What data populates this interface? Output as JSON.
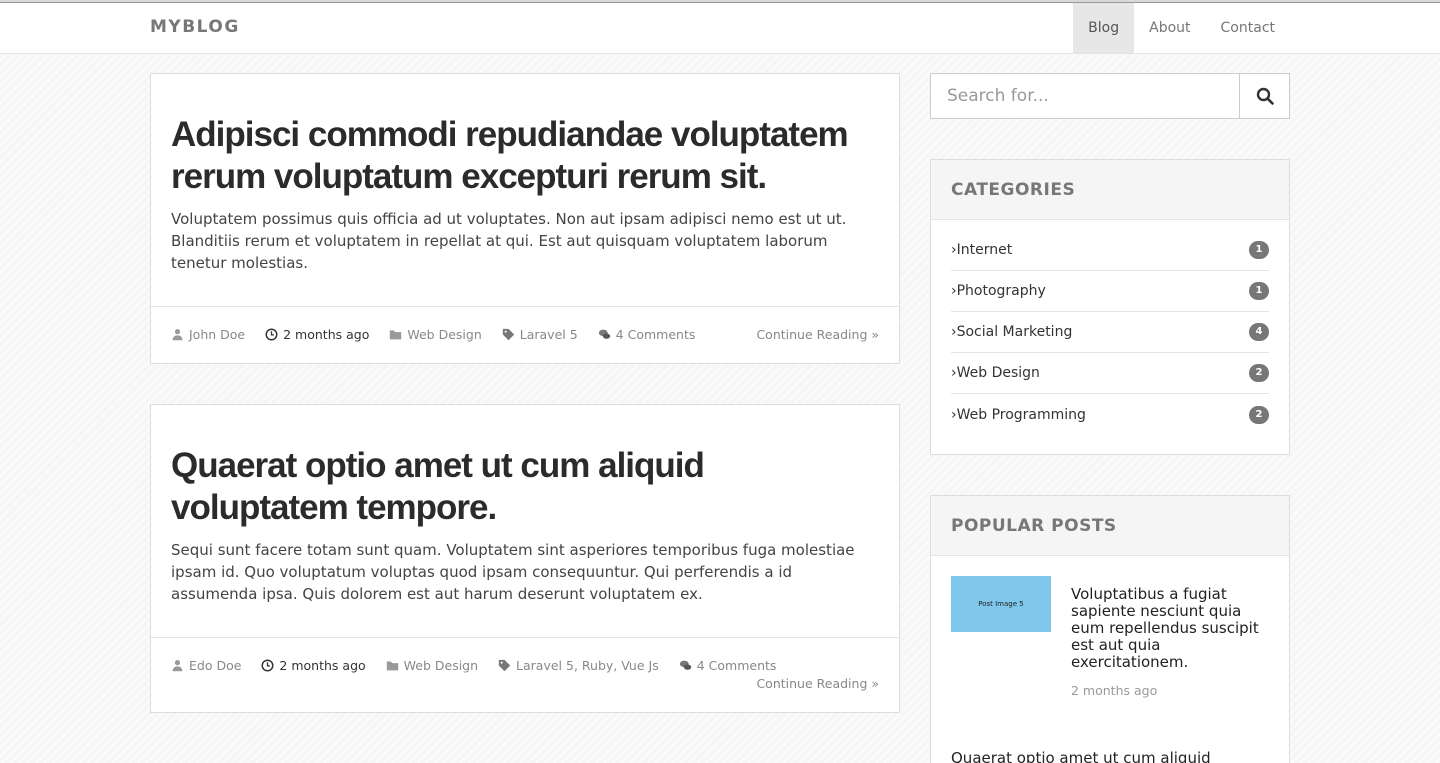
{
  "navbar": {
    "brand": "MYBLOG",
    "links": [
      "Blog",
      "About",
      "Contact"
    ],
    "active": "Blog"
  },
  "posts": [
    {
      "title": "Adipisci commodi repudiandae voluptatem rerum voluptatum excepturi rerum sit.",
      "excerpt": "Voluptatem possimus quis officia ad ut voluptates. Non aut ipsam adipisci nemo est ut ut. Blanditiis rerum et voluptatem in repellat at qui. Est aut quisquam voluptatem laborum tenetur molestias.",
      "author": "John Doe",
      "time": "2 months ago",
      "category": "Web Design",
      "tags": "Laravel 5",
      "comments": "4 Comments",
      "continue": "Continue Reading »"
    },
    {
      "title": "Quaerat optio amet ut cum aliquid voluptatem tempore.",
      "excerpt": "Sequi sunt facere totam sunt quam. Voluptatem sint asperiores temporibus fuga molestiae ipsam id. Quo voluptatum voluptas quod ipsam consequuntur. Qui perferendis a id assumenda ipsa. Quis dolorem est aut harum deserunt voluptatem ex.",
      "author": "Edo Doe",
      "time": "2 months ago",
      "category": "Web Design",
      "tags": "Laravel 5, Ruby, Vue Js",
      "comments": "4 Comments",
      "continue": "Continue Reading »"
    }
  ],
  "search": {
    "placeholder": "Search for..."
  },
  "categories": {
    "title": "CATEGORIES",
    "items": [
      {
        "label": "›Internet",
        "count": "1"
      },
      {
        "label": "›Photography",
        "count": "1"
      },
      {
        "label": "›Social Marketing",
        "count": "4"
      },
      {
        "label": "›Web Design",
        "count": "2"
      },
      {
        "label": "›Web Programming",
        "count": "2"
      }
    ]
  },
  "popular": {
    "title": "POPULAR POSTS",
    "items": [
      {
        "thumb": "Post Image 5",
        "title": "Voluptatibus a fugiat sapiente nesciunt quia eum repellendus suscipit est aut quia exercitationem.",
        "date": "2 months ago"
      },
      {
        "title": "Quaerat optio amet ut cum aliquid"
      }
    ]
  }
}
